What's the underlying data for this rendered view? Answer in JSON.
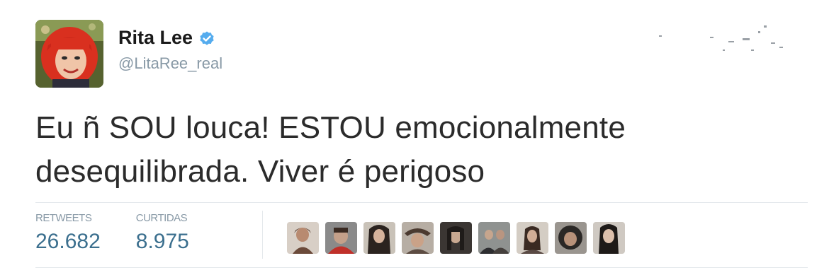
{
  "tweet": {
    "display_name": "Rita Lee",
    "handle": "@LitaRee_real",
    "text_line1": "Eu ñ SOU louca! ESTOU emocionalmente",
    "text_line2": "desequilibrada. Viver é perigoso"
  },
  "stats": {
    "retweets_label": "RETWEETS",
    "retweets_value": "26.682",
    "likes_label": "CURTIDAS",
    "likes_value": "8.975"
  },
  "icons": {
    "verified": "verified-badge-icon",
    "avatar": "profile-avatar"
  },
  "colors": {
    "verified_blue": "#55acee",
    "stat_value": "#3b6f8e",
    "muted": "#8899a6"
  },
  "likers_count": 9
}
